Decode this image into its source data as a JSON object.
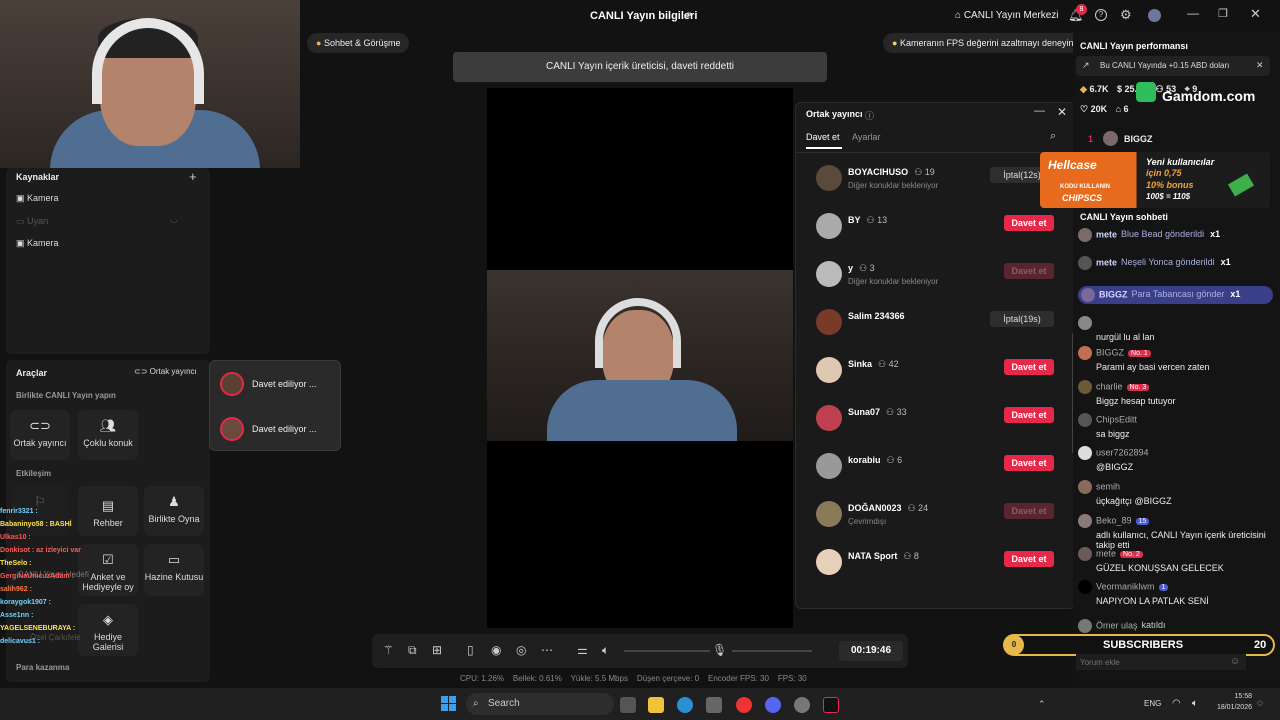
{
  "window": {
    "title": "CANLI Yayın bilgileri",
    "center_btn": "CANLI Yayın Merkezi",
    "notif_count": "8"
  },
  "chips": {
    "left": "Sohbet & Görüşme",
    "right": "Kameranın FPS değerini azaltmayı deneyin"
  },
  "banner": "CANLI Yayın içerik üreticisi, daveti reddetti",
  "left_panel": {
    "sources_title": "Kaynaklar",
    "sources": [
      "Kamera",
      "Uyarı",
      "Kamera"
    ],
    "tools_title": "Araçlar",
    "cohost_btn": "Ortak yayıncı",
    "together_title": "Birlikte CANLI Yayın yapın",
    "tools": [
      "Ortak yayıncı",
      "Çoklu konuk"
    ],
    "interaction_title": "Etkileşim",
    "inter_tools": [
      "Rehber",
      "Birlikte Oyna",
      "Anket ve Hediyeyle oy",
      "Hazine Kutusu",
      "Hediye Galerisi"
    ],
    "faint_tools": [
      "CANLI Yayın Hedefi",
      "Özel Çarkıfele"
    ],
    "earn_title": "Para kazanma"
  },
  "inviting": [
    "Davet ediliyor ...",
    "Davet ediliyor ..."
  ],
  "overlay_chat": [
    "fenrir3321 :",
    "Babaninyo58 : BASHİ",
    "Ulkas10 :",
    "Donkisot : az izleyici var",
    "TheSelo :",
    "GergiNaUnicuzAdam :",
    "salih962 :",
    "koraygok1907 :",
    "Asse1nn :",
    "YAGELSENEBURAYA :",
    "delicavus1 :"
  ],
  "cohost": {
    "title": "Ortak yayıncı",
    "tabs": [
      "Davet et",
      "Ayarlar"
    ],
    "rows": [
      {
        "name": "BOYACIHUSO",
        "count": "19",
        "sub": "Diğer konuklar bekleniyor",
        "action": "İptal(12s)",
        "kind": "cancel"
      },
      {
        "name": "BY",
        "count": "13",
        "sub": "",
        "action": "Davet et",
        "kind": "invite"
      },
      {
        "name": "y",
        "count": "3",
        "sub": "Diğer konuklar bekleniyor",
        "action": "Davet et",
        "kind": "off"
      },
      {
        "name": "Salim 234366",
        "count": "",
        "sub": "",
        "action": "İptal(19s)",
        "kind": "cancel"
      },
      {
        "name": "Sinka",
        "count": "42",
        "sub": "",
        "action": "Davet et",
        "kind": "invite"
      },
      {
        "name": "Suna07",
        "count": "33",
        "sub": "",
        "action": "Davet et",
        "kind": "invite"
      },
      {
        "name": "korabiu",
        "count": "6",
        "sub": "",
        "action": "Davet et",
        "kind": "invite"
      },
      {
        "name": "DOĞAN0023",
        "count": "24",
        "sub": "Çevrimdışı",
        "action": "Davet et",
        "kind": "off"
      },
      {
        "name": "NATA Sport",
        "count": "8",
        "sub": "",
        "action": "Davet et",
        "kind": "invite"
      }
    ]
  },
  "perf": {
    "title": "CANLI Yayın performansı",
    "earn_note": "Bu CANLI Yayında +0.15 ABD doları",
    "stats": [
      "6.7K",
      "25.04",
      "53",
      "9"
    ],
    "likes": "20K",
    "viewers": "6",
    "top_user": "BIGGZ",
    "top_rank": "1",
    "gamdom": "Gamdom.com"
  },
  "hellcase": {
    "brand": "Hellcase",
    "code_label": "KODU KULLANIN",
    "code": "CHIPSCS",
    "line1": "Yeni kullanıcılar",
    "line2": "için 0,75",
    "line3": "10% bonus",
    "line4": "100$ = 110$"
  },
  "chat": {
    "title": "CANLI Yayın sohbeti",
    "messages": [
      {
        "user": "mete",
        "text": "Blue Bead gönderildi",
        "extra": "x1"
      },
      {
        "user": "mete",
        "text": "Neşeli Yonca gönderildi",
        "extra": "x1"
      },
      {
        "user": "BIGGZ",
        "text": "Para Tabancası gönder",
        "extra": "x1"
      },
      {
        "user": "",
        "text": "nurgül lu al lan",
        "extra": ""
      },
      {
        "user": "BIGGZ",
        "text": "Parami ay basi vercen zaten",
        "extra": "No. 1"
      },
      {
        "user": "charlie",
        "text": "Biggz hesap tutuyor",
        "extra": "No. 3"
      },
      {
        "user": "ChipsEditt",
        "text": "sa biggz",
        "extra": ""
      },
      {
        "user": "user7262894",
        "text": "@BIGGZ",
        "extra": ""
      },
      {
        "user": "semih",
        "text": "üçkağıtçı @BIGGZ",
        "extra": ""
      },
      {
        "user": "Beko_89",
        "text": "adlı kullanıcı, CANLI Yayın içerik üreticisini takip etti",
        "extra": "15"
      },
      {
        "user": "mete",
        "text": "GÜZEL KONUŞSAN GELECEK",
        "extra": "No. 2"
      },
      {
        "user": "Veormaniklwm",
        "text": "NAPIYON LA PATLAK SENİ",
        "extra": "1"
      },
      {
        "user": "Ömer ulaş",
        "text": "katıldı",
        "extra": ""
      }
    ],
    "input_placeholder": "Yorum ekle"
  },
  "subs": {
    "label": "SUBSCRIBERS",
    "current": "0",
    "goal": "20"
  },
  "controls": {
    "timer": "00:19:46"
  },
  "status": {
    "cpu": "CPU: 1.26%",
    "mem": "Bellek: 0.61%",
    "upload": "Yükle: 5.5 Mbps",
    "drop": "Düşen çerçeve: 0",
    "enc": "Encoder FPS: 30",
    "fps": "FPS: 30"
  },
  "taskbar": {
    "search": "Search",
    "lang": "ENG",
    "time": "15:58",
    "date": "18/01/2026"
  }
}
